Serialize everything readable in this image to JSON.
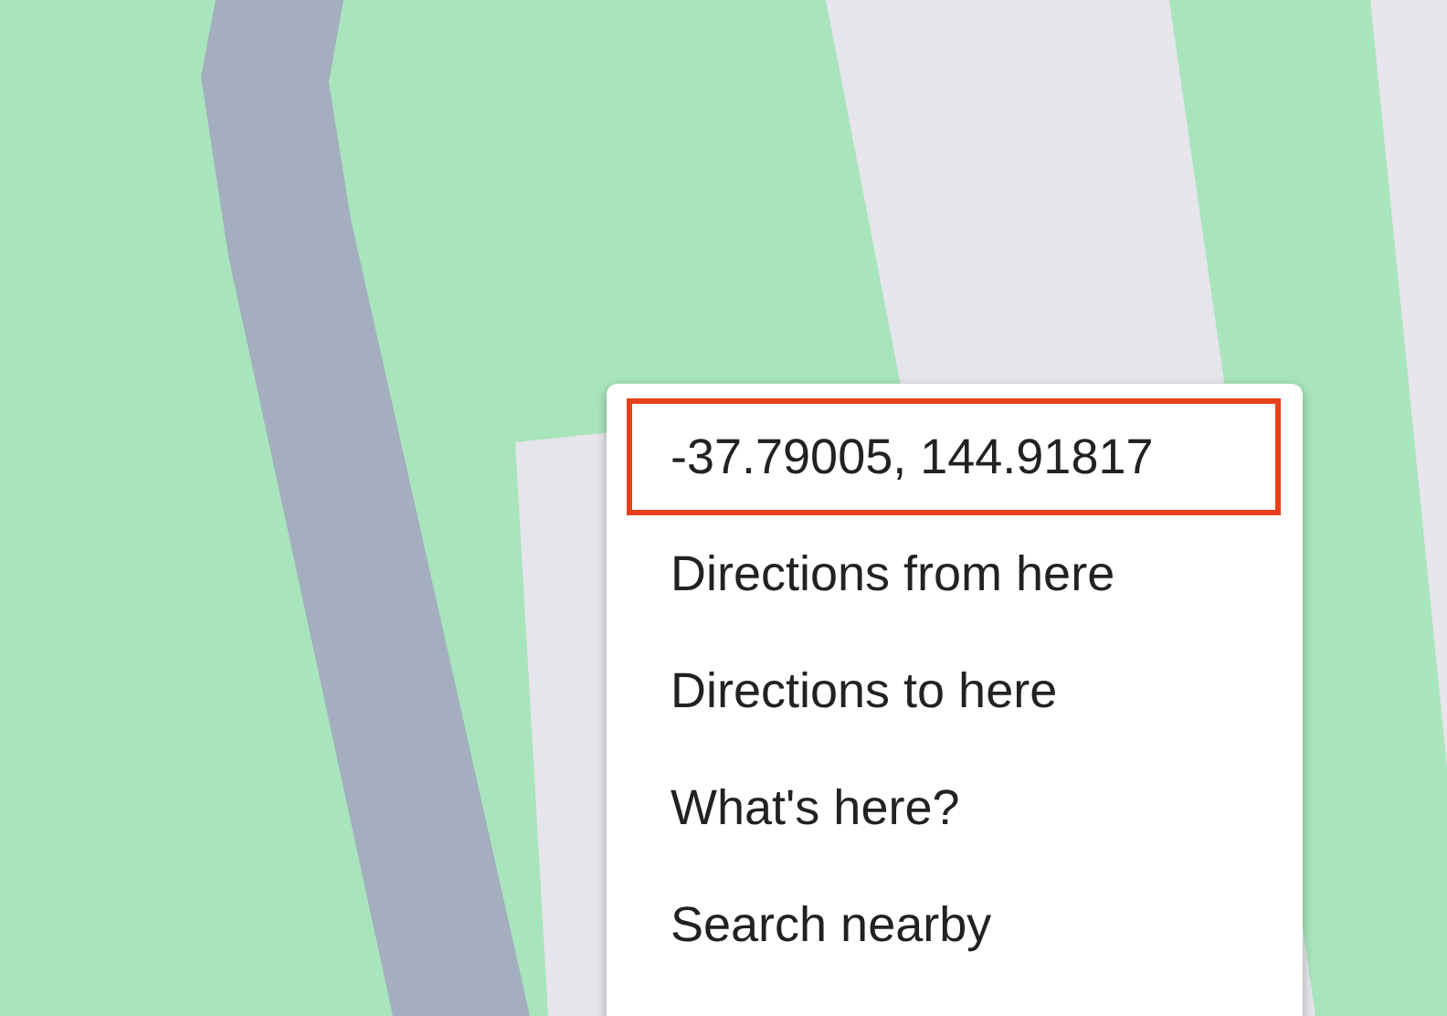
{
  "context_menu": {
    "items": [
      {
        "label": "-37.79005, 144.91817",
        "highlighted": true
      },
      {
        "label": "Directions from here",
        "highlighted": false
      },
      {
        "label": "Directions to here",
        "highlighted": false
      },
      {
        "label": "What's here?",
        "highlighted": false
      },
      {
        "label": "Search nearby",
        "highlighted": false
      }
    ]
  }
}
